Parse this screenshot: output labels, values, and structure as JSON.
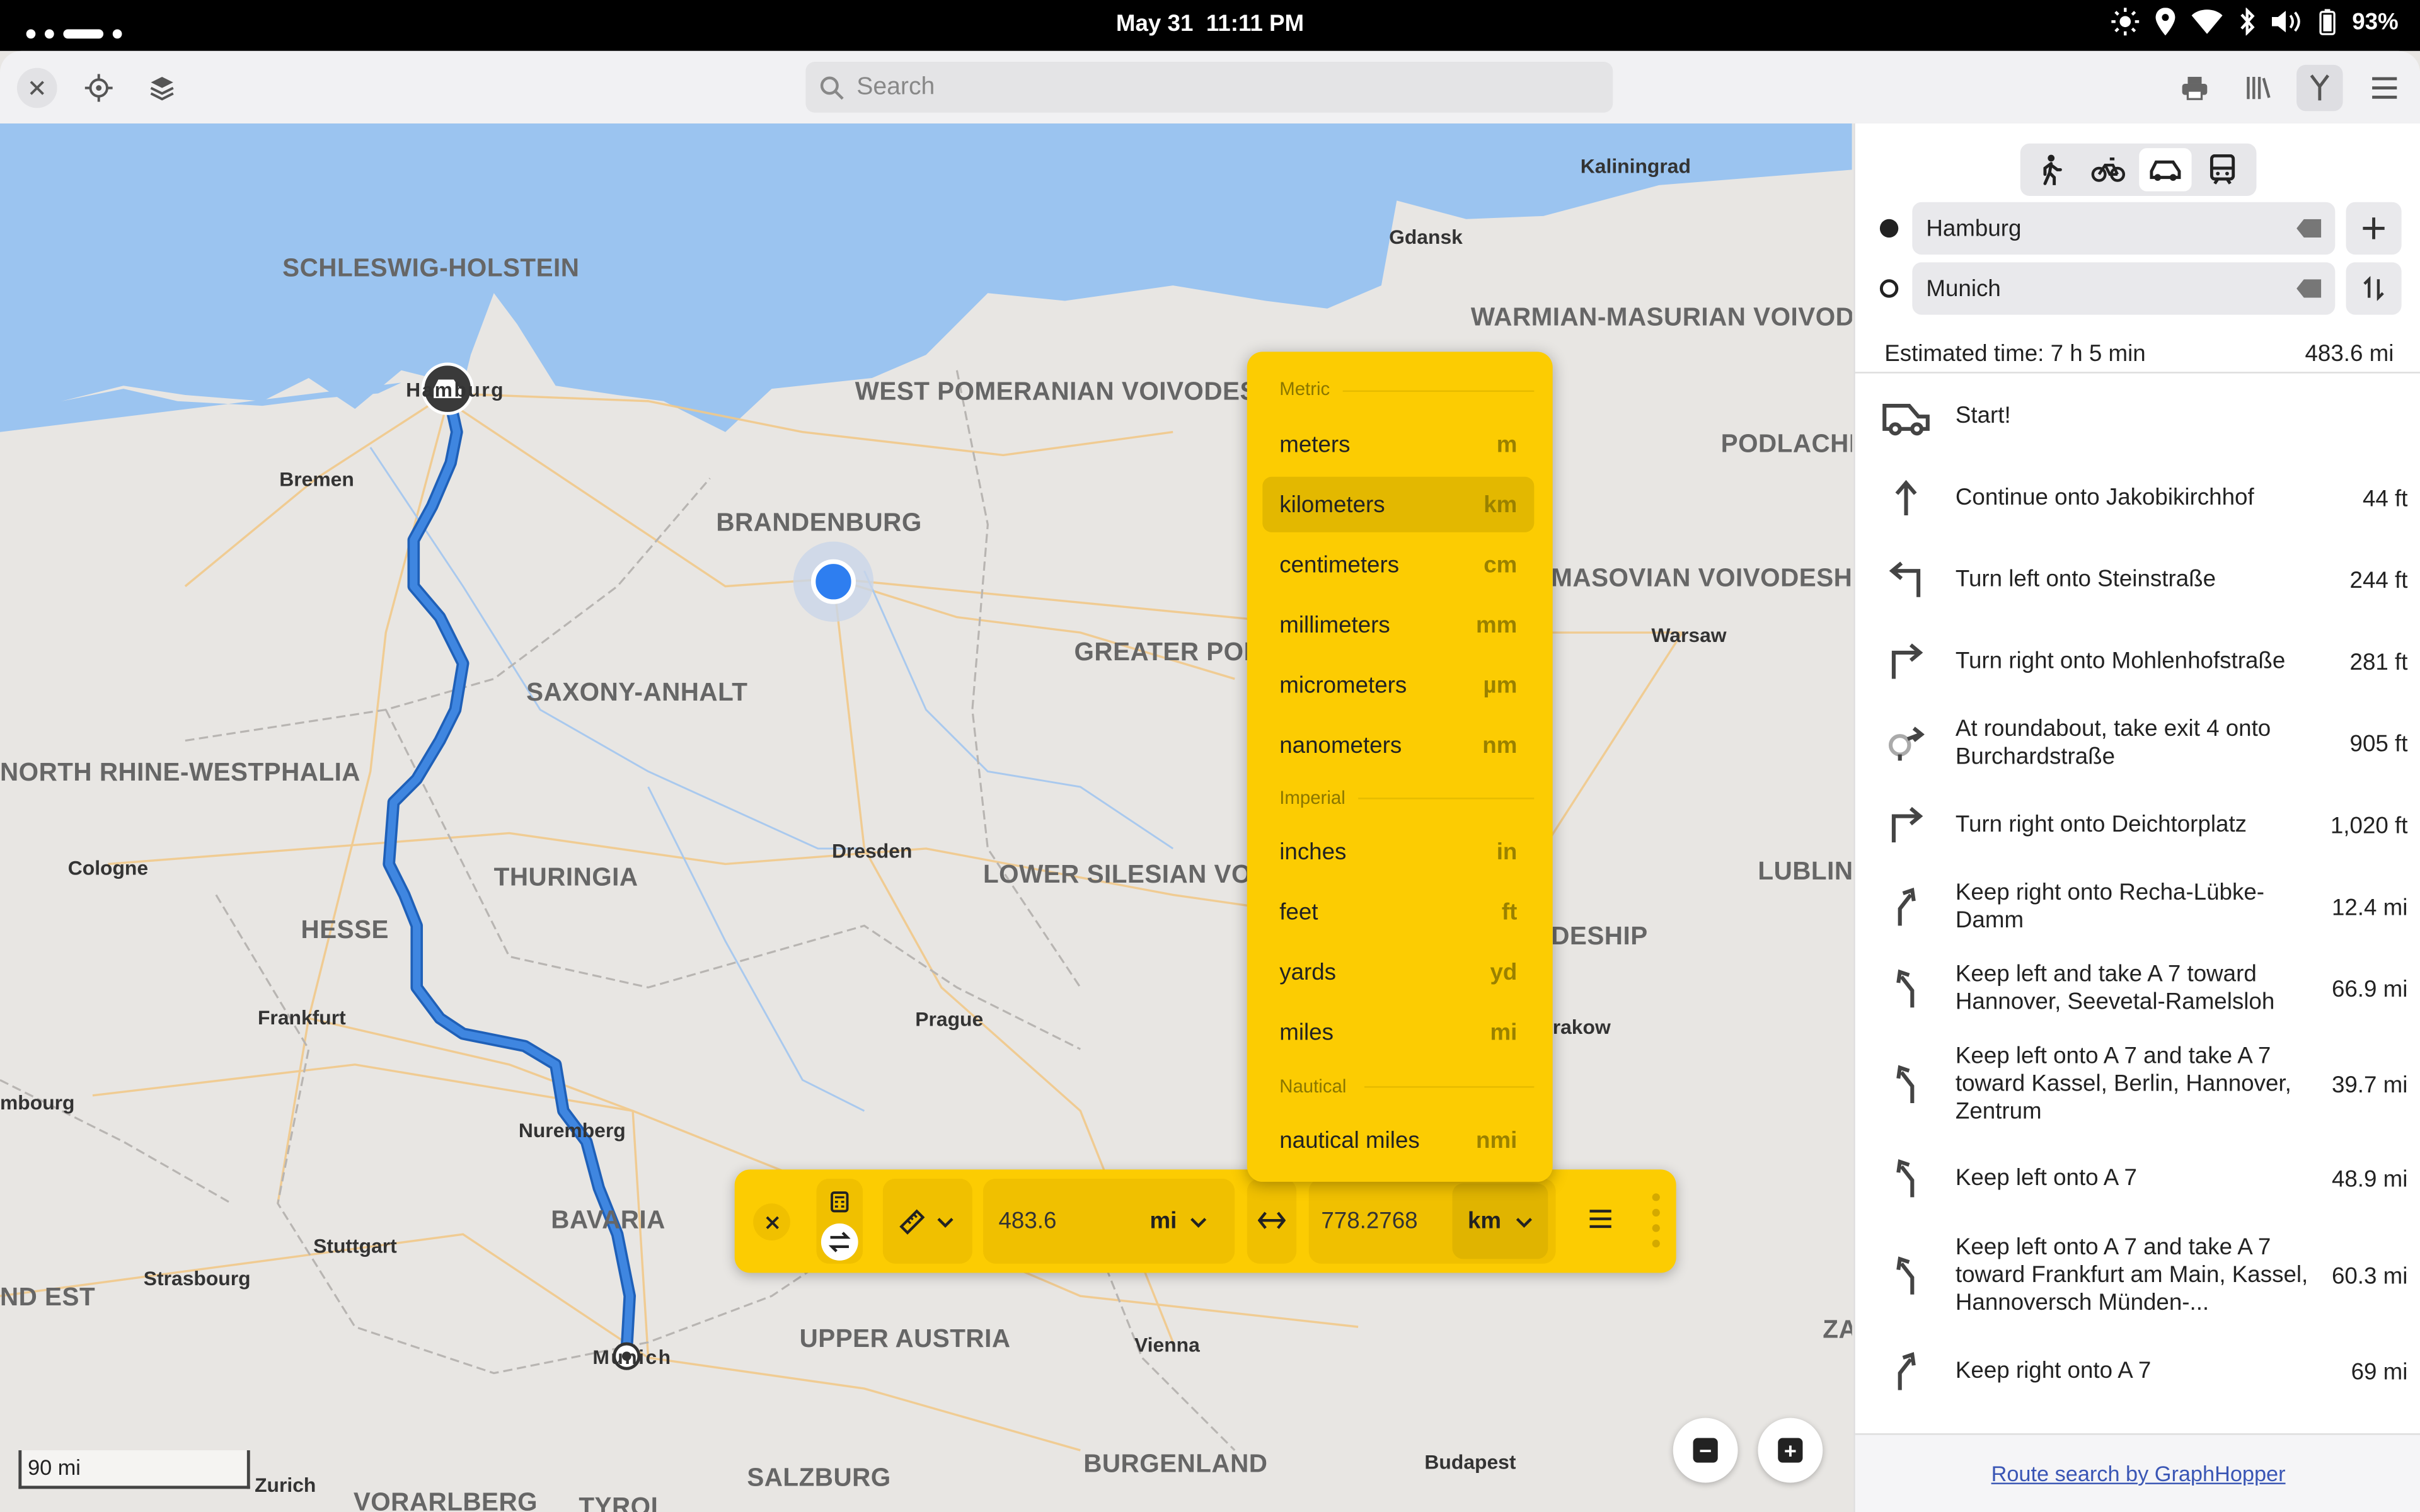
{
  "status_bar": {
    "date": "May 31",
    "time": "11:11 PM",
    "battery": "93%",
    "icons": [
      "brightness-icon",
      "location-icon",
      "wifi-icon",
      "bluetooth-icon",
      "volume-icon",
      "battery-icon"
    ]
  },
  "toolbar": {
    "search_placeholder": "Search",
    "left_icons": [
      "close-icon",
      "locate-icon",
      "layers-icon"
    ],
    "right_icons": [
      "print-icon",
      "library-icon",
      "route-icon",
      "menu-icon"
    ]
  },
  "map": {
    "colors": {
      "land": "#e8e6e3",
      "water": "#9bc4f0",
      "route": "#3f86e0",
      "roads": "#f1c98a"
    },
    "scale_label": "90 mi",
    "labels": {
      "schleswig_holstein": "SCHLESWIG-HOLSTEIN",
      "west_pomeranian": "WEST POMERANIAN VOIVODES",
      "warmian_masurian": "WARMIAN-MASURIAN VOIVOD",
      "podlachia": "PODLACHI",
      "brandenburg": "BRANDENBURG",
      "masovian": "MASOVIAN VOIVODESH",
      "greater_poland": "GREATER POL",
      "saxony_anhalt": "SAXONY-ANHALT",
      "north_rhine_westphalia": "NORTH RHINE-WESTPHALIA",
      "thuringia": "THURINGIA",
      "lower_silesian": "LOWER SILESIAN VOI",
      "lublin": "LUBLIN",
      "hesse": "HESSE",
      "deship": "DESHIP",
      "bavaria": "BAVARIA",
      "upper_austria": "UPPER AUSTRIA",
      "nd_est": "ND EST",
      "burgenland": "BURGENLAND",
      "salzburg": "SALZBURG",
      "vorarlberg": "VORARLBERG",
      "tyrol": "TYROL",
      "kaliningrad": "Kaliningrad",
      "gdansk": "Gdansk",
      "hamburg": "Hamburg",
      "bremen": "Bremen",
      "warsaw": "Warsaw",
      "cologne": "Cologne",
      "dresden": "Dresden",
      "frankfurt": "Frankfurt",
      "prague": "Prague",
      "krakow": "rakow",
      "luxembourg": "mbourg",
      "nuremberg": "Nuremberg",
      "stuttgart": "Stuttgart",
      "strasbourg": "Strasbourg",
      "munich": "Munich",
      "vienna": "Vienna",
      "zurich": "Zurich",
      "budapest": "Budapest",
      "za": "ZA"
    }
  },
  "route_panel": {
    "modes": [
      "walk-icon",
      "bike-icon",
      "car-icon",
      "transit-icon"
    ],
    "active_mode": "car-icon",
    "origin": "Hamburg",
    "destination": "Munich",
    "estimated_time": "Estimated time: 7 h 5 min",
    "total_distance": "483.6 mi",
    "steps": [
      {
        "icon": "car-icon",
        "text": "Start!",
        "distance": ""
      },
      {
        "icon": "arrow-up-icon",
        "text": "Continue onto Jakobikirchhof",
        "distance": "44 ft"
      },
      {
        "icon": "turn-left-icon",
        "text": "Turn left onto Steinstraße",
        "distance": "244 ft"
      },
      {
        "icon": "turn-right-icon",
        "text": "Turn right onto Mohlenhofstraße",
        "distance": "281 ft"
      },
      {
        "icon": "roundabout-icon",
        "text": "At roundabout, take exit 4 onto Burchardstraße",
        "distance": "905 ft"
      },
      {
        "icon": "turn-right-icon",
        "text": "Turn right onto Deichtorplatz",
        "distance": "1,020 ft"
      },
      {
        "icon": "keep-right-icon",
        "text": "Keep right onto Recha-Lübke-Damm",
        "distance": "12.4 mi"
      },
      {
        "icon": "keep-left-icon",
        "text": "Keep left and take A 7 toward Hannover, Seevetal-Ramelsloh",
        "distance": "66.9 mi"
      },
      {
        "icon": "keep-left-icon",
        "text": "Keep left onto A 7 and take A 7 toward Kassel, Berlin, Hannover, Zentrum",
        "distance": "39.7 mi"
      },
      {
        "icon": "keep-left-icon",
        "text": "Keep left onto A 7",
        "distance": "48.9 mi"
      },
      {
        "icon": "keep-left-icon",
        "text": "Keep left onto A 7 and take A 7 toward Frankfurt am Main, Kassel, Hannoversch Münden-...",
        "distance": "60.3 mi"
      },
      {
        "icon": "keep-right-icon",
        "text": "Keep right onto A 7",
        "distance": "69 mi"
      }
    ],
    "footer_link": "Route search by GraphHopper"
  },
  "converter": {
    "accent": "#fccc02",
    "input_value": "483.6",
    "input_unit": "mi",
    "output_value": "778.2768",
    "output_unit": "km",
    "dropdown": {
      "groups": [
        {
          "label": "Metric",
          "items": [
            {
              "name": "meters",
              "symbol": "m"
            },
            {
              "name": "kilometers",
              "symbol": "km",
              "selected": true
            },
            {
              "name": "centimeters",
              "symbol": "cm"
            },
            {
              "name": "millimeters",
              "symbol": "mm"
            },
            {
              "name": "micrometers",
              "symbol": "µm"
            },
            {
              "name": "nanometers",
              "symbol": "nm"
            }
          ]
        },
        {
          "label": "Imperial",
          "items": [
            {
              "name": "inches",
              "symbol": "in"
            },
            {
              "name": "feet",
              "symbol": "ft"
            },
            {
              "name": "yards",
              "symbol": "yd"
            },
            {
              "name": "miles",
              "symbol": "mi"
            }
          ]
        },
        {
          "label": "Nautical",
          "items": [
            {
              "name": "nautical miles",
              "symbol": "nmi"
            }
          ]
        }
      ]
    }
  }
}
